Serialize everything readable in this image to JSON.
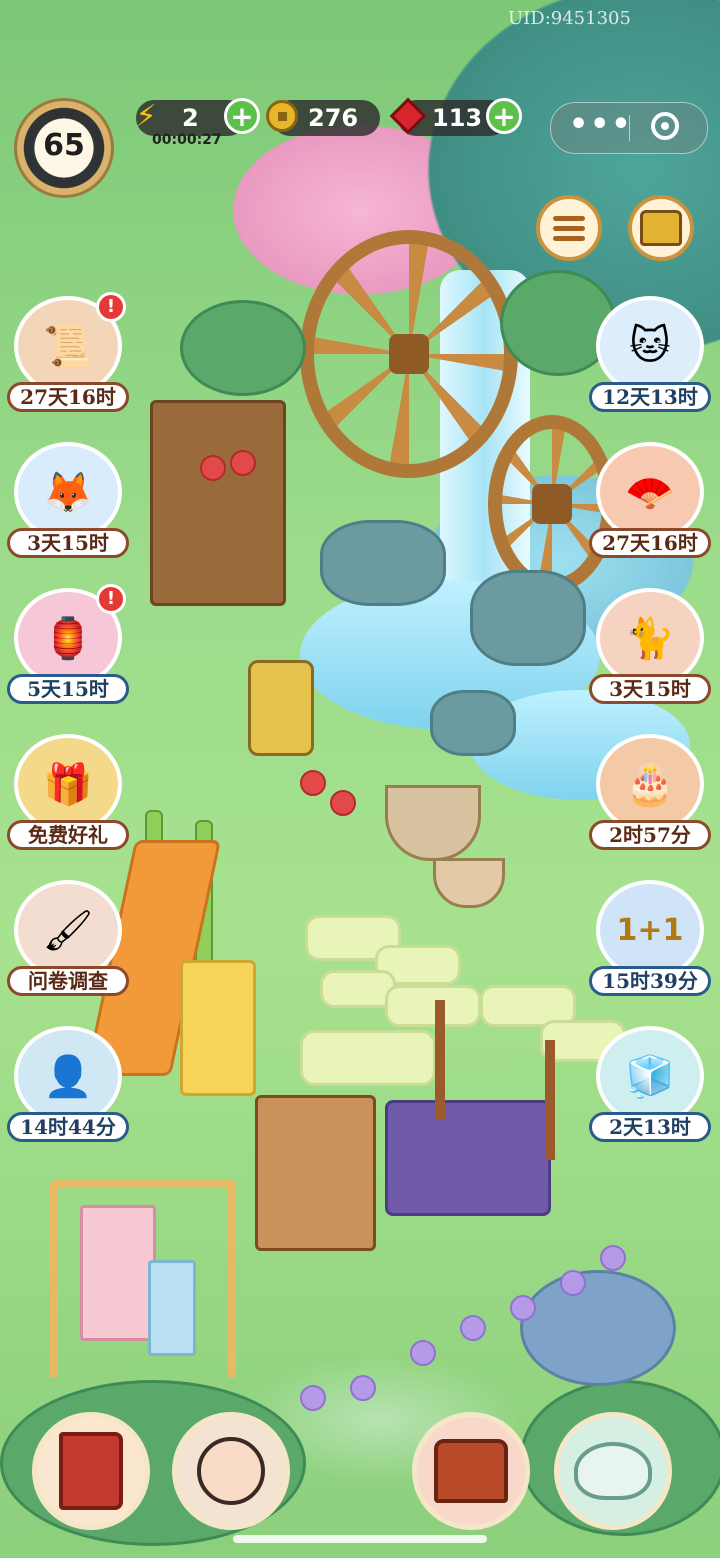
{
  "hud": {
    "level": "65",
    "energy": "2",
    "energy_timer": "00:00:27",
    "coins": "276",
    "gems": "113",
    "uid": "UID:9451305",
    "menu_dots": "•••"
  },
  "left_events": [
    {
      "label": "27天16时",
      "alert": true,
      "icon": "scroll-icon",
      "style": "brown"
    },
    {
      "label": "3天15时",
      "alert": false,
      "icon": "fox-icon",
      "style": "brown"
    },
    {
      "label": "5天15时",
      "alert": true,
      "icon": "lantern-icon",
      "style": "blue"
    },
    {
      "label": "免费好礼",
      "alert": false,
      "icon": "gift-icon",
      "style": "brown"
    },
    {
      "label": "问卷调查",
      "alert": false,
      "icon": "survey-icon",
      "style": "brown"
    },
    {
      "label": "14时44分",
      "alert": false,
      "icon": "character-icon",
      "style": "blue"
    }
  ],
  "right_events": [
    {
      "label": "12天13时",
      "icon": "cat-cloud-icon",
      "style": "brown"
    },
    {
      "label": "27天16时",
      "icon": "fan-icon",
      "style": "brown"
    },
    {
      "label": "3天15时",
      "icon": "cat-fan-icon",
      "style": "brown"
    },
    {
      "label": "2时57分",
      "icon": "cake-icon",
      "style": "brown"
    },
    {
      "label": "15时39分",
      "icon": "plus-one-icon",
      "style": "blue"
    },
    {
      "label": "2天13时",
      "icon": "gift-box-icon",
      "style": "blue"
    }
  ],
  "alert_mark": "!",
  "colors": {
    "grass": "#9bdb8a",
    "water": "#7fd3ee",
    "label_border": "#8a4a2b",
    "alert": "#e53935",
    "plus": "#5cc04a"
  }
}
